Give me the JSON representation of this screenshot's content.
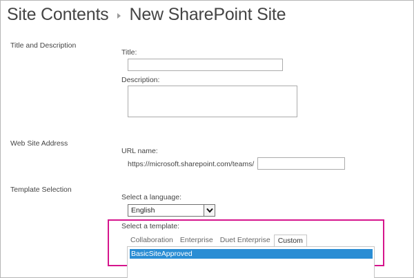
{
  "header": {
    "breadcrumb_root": "Site Contents",
    "page_title": "New SharePoint Site"
  },
  "sections": {
    "title_description": {
      "label": "Title and Description",
      "title_label": "Title:",
      "title_value": "",
      "description_label": "Description:",
      "description_value": ""
    },
    "web_address": {
      "label": "Web Site Address",
      "url_label": "URL name:",
      "url_prefix": "https://microsoft.sharepoint.com/teams/",
      "url_value": ""
    },
    "template_selection": {
      "label": "Template Selection",
      "language_label": "Select a language:",
      "language_selected": "English",
      "template_label": "Select a template:",
      "tabs": [
        {
          "label": "Collaboration",
          "selected": false
        },
        {
          "label": "Enterprise",
          "selected": false
        },
        {
          "label": "Duet Enterprise",
          "selected": false
        },
        {
          "label": "Custom",
          "selected": true
        }
      ],
      "templates": [
        "BasicSiteApproved"
      ],
      "selected_template": "BasicSiteApproved"
    }
  },
  "colors": {
    "highlight_border": "#d5148c",
    "selected_item_bg": "#2a8dd4",
    "text": "#444444"
  }
}
